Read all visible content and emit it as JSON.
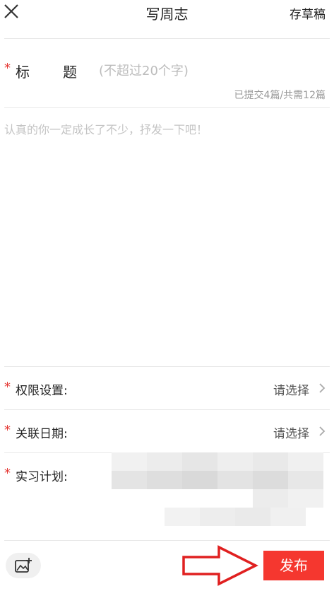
{
  "header": {
    "title": "写周志",
    "close_icon": "close-icon",
    "draft_label": "存草稿"
  },
  "title_field": {
    "label_part1": "标",
    "label_part2": "题",
    "placeholder": "(不超过20个字)",
    "value": ""
  },
  "count_text": "已提交4篇/共需12篇",
  "content": {
    "placeholder": "认真的你一定成长了不少，抒发一下吧！",
    "value": ""
  },
  "form": {
    "permission": {
      "label": "权限设置:",
      "value": "请选择"
    },
    "date": {
      "label": "关联日期:",
      "value": "请选择"
    },
    "plan": {
      "label": "实习计划:"
    }
  },
  "footer": {
    "image_icon": "add-image-icon",
    "publish_label": "发布"
  },
  "colors": {
    "accent": "#f5372f",
    "required_star": "#e53935",
    "annotation_arrow": "#e02020"
  }
}
